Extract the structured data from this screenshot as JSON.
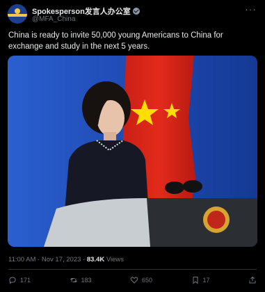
{
  "account": {
    "display_name": "Spokesperson发言人办公室",
    "handle": "@MFA_China"
  },
  "tweet": {
    "text": "China is ready to invite 50,000 young Americans to China for exchange and study in the next 5 years."
  },
  "media": {
    "alt": "Spokeswoman at a podium in front of a Chinese flag"
  },
  "meta": {
    "time": "11:00 AM",
    "separator": "·",
    "date": "Nov 17, 2023",
    "views_count": "83.4K",
    "views_label": "Views"
  },
  "actions": {
    "replies": "171",
    "reposts": "183",
    "likes": "650",
    "bookmarks": "17"
  },
  "colors": {
    "background": "#000000",
    "text": "#e7e9ea",
    "muted": "#71767b",
    "flag_red": "#de2910",
    "flag_star": "#ffde00",
    "backdrop_blue": "#1f4bb7"
  }
}
